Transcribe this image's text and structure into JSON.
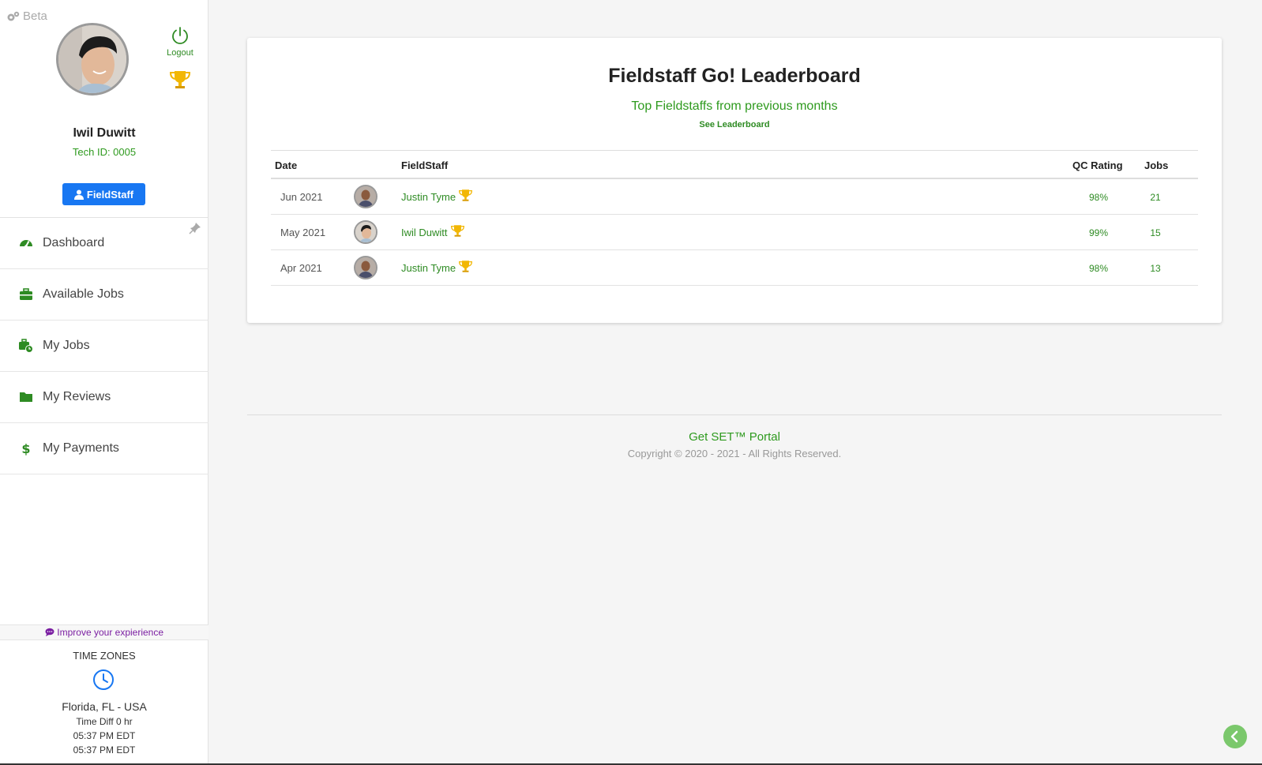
{
  "sidebar": {
    "beta_label": "Beta",
    "logout_label": "Logout",
    "user_name": "Iwil Duwitt",
    "tech_id": "Tech ID: 0005",
    "role_label": "FieldStaff",
    "nav": [
      {
        "label": "Dashboard",
        "icon": "dashboard-icon"
      },
      {
        "label": "Available Jobs",
        "icon": "briefcase-icon"
      },
      {
        "label": "My Jobs",
        "icon": "briefcase-clock-icon"
      },
      {
        "label": "My Reviews",
        "icon": "folder-icon"
      },
      {
        "label": "My Payments",
        "icon": "dollar-icon"
      }
    ],
    "improve_label": "Improve your expierience",
    "timezone": {
      "title": "TIME ZONES",
      "location": "Florida, FL - USA",
      "time_diff": "Time Diff 0 hr",
      "time_local": "05:37 PM EDT",
      "time_remote": "05:37 PM EDT"
    }
  },
  "leaderboard": {
    "title": "Fieldstaff Go! Leaderboard",
    "subtitle": "Top Fieldstaffs from previous months",
    "link": "See Leaderboard",
    "columns": {
      "date": "Date",
      "fieldstaff": "FieldStaff",
      "qc": "QC Rating",
      "jobs": "Jobs"
    },
    "rows": [
      {
        "date": "Jun 2021",
        "name": "Justin Tyme",
        "qc": "98%",
        "jobs": "21"
      },
      {
        "date": "May 2021",
        "name": "Iwil Duwitt",
        "qc": "99%",
        "jobs": "15"
      },
      {
        "date": "Apr 2021",
        "name": "Justin Tyme",
        "qc": "98%",
        "jobs": "13"
      }
    ]
  },
  "footer": {
    "title": "Get SET™ Portal",
    "copyright": "Copyright © 2020 - 2021 - All Rights Reserved."
  },
  "colors": {
    "accent_green": "#2e8b23",
    "primary_blue": "#1877f2",
    "trophy_gold": "#f2b705"
  }
}
